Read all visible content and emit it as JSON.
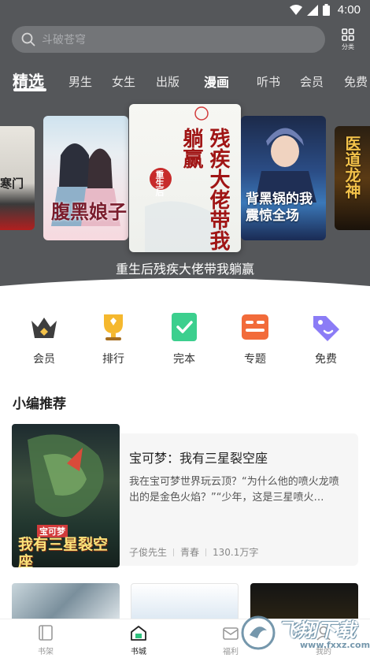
{
  "status_bar": {
    "time": "4:00"
  },
  "search": {
    "placeholder": "斗破苍穹"
  },
  "category": {
    "label": "分类"
  },
  "nav_tabs": [
    {
      "label": "精选",
      "active": true
    },
    {
      "label": "男生"
    },
    {
      "label": "女生"
    },
    {
      "label": "出版"
    },
    {
      "label": "漫画",
      "bold": true
    },
    {
      "label": "听书"
    },
    {
      "label": "会员"
    },
    {
      "label": "免费"
    }
  ],
  "carousel": {
    "caption": "重生后残疾大佬带我躺赢",
    "covers": [
      {
        "title": "寒门"
      },
      {
        "title": "腹黑娘子"
      },
      {
        "title": "残疾大佬带我躺赢",
        "badge": "重生后"
      },
      {
        "title": "背黑锅的我震惊全场"
      },
      {
        "title": "医道龙神"
      }
    ]
  },
  "quick_entries": [
    {
      "label": "会员",
      "icon": "crown-icon",
      "color": "#444444"
    },
    {
      "label": "排行",
      "icon": "trophy-icon",
      "color": "#f5b82e"
    },
    {
      "label": "完本",
      "icon": "check-box-icon",
      "color": "#3ccf8e"
    },
    {
      "label": "专题",
      "icon": "topic-icon",
      "color": "#f26b3a"
    },
    {
      "label": "免费",
      "icon": "tag-icon",
      "color": "#8b7cf6"
    }
  ],
  "section": {
    "title": "小编推荐"
  },
  "recommend": {
    "title": "宝可梦：我有三星裂空座",
    "description": "我在宝可梦世界玩云顶？“为什么他的喷火龙喷出的是金色火焰？”“少年，这是三星喷火…",
    "author": "子俊先生",
    "genre": "青春",
    "word_count": "130.1万字",
    "cover_text": "我有三星裂空座",
    "cover_brand": "宝可梦"
  },
  "bottom_nav": [
    {
      "label": "书架",
      "icon": "bookshelf-icon"
    },
    {
      "label": "书城",
      "icon": "bookstore-icon",
      "active": true
    },
    {
      "label": "福利",
      "icon": "gift-icon"
    },
    {
      "label": "我的",
      "icon": "profile-icon"
    }
  ],
  "watermark": {
    "text": "飞翔下载",
    "url": "www.fxxz.com"
  },
  "colors": {
    "header_bg": "#55575a",
    "search_bg": "#737578"
  }
}
